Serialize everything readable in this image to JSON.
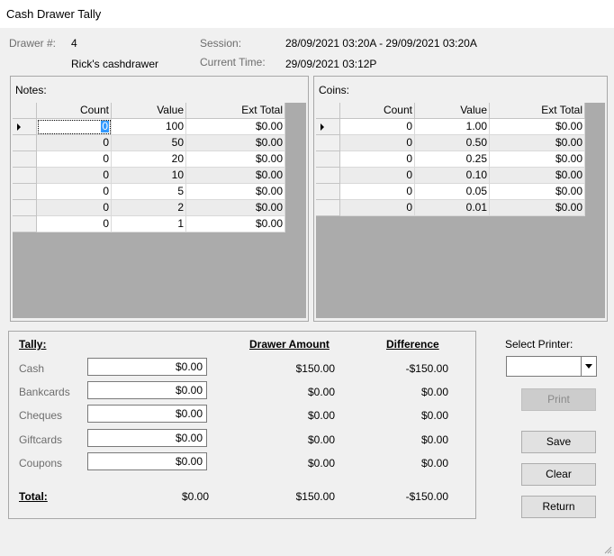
{
  "window": {
    "title": "Cash Drawer Tally"
  },
  "header": {
    "drawer_label": "Drawer #:",
    "drawer_number": "4",
    "drawer_name": "Rick's cashdrawer",
    "session_label": "Session:",
    "session_value": "28/09/2021 03:20A - 29/09/2021 03:20A",
    "current_time_label": "Current Time:",
    "current_time_value": "29/09/2021 03:12P"
  },
  "notes": {
    "title": "Notes:",
    "columns": [
      "Count",
      "Value",
      "Ext Total"
    ],
    "rows": [
      [
        "0",
        "100",
        "$0.00"
      ],
      [
        "0",
        "50",
        "$0.00"
      ],
      [
        "0",
        "20",
        "$0.00"
      ],
      [
        "0",
        "10",
        "$0.00"
      ],
      [
        "0",
        "5",
        "$0.00"
      ],
      [
        "0",
        "2",
        "$0.00"
      ],
      [
        "0",
        "1",
        "$0.00"
      ]
    ]
  },
  "coins": {
    "title": "Coins:",
    "columns": [
      "Count",
      "Value",
      "Ext Total"
    ],
    "rows": [
      [
        "0",
        "1.00",
        "$0.00"
      ],
      [
        "0",
        "0.50",
        "$0.00"
      ],
      [
        "0",
        "0.25",
        "$0.00"
      ],
      [
        "0",
        "0.10",
        "$0.00"
      ],
      [
        "0",
        "0.05",
        "$0.00"
      ],
      [
        "0",
        "0.01",
        "$0.00"
      ]
    ]
  },
  "tally": {
    "heading": "Tally:",
    "drawer_amount_heading": "Drawer Amount",
    "difference_heading": "Difference",
    "rows": [
      {
        "label": "Cash",
        "tally": "$0.00",
        "drawer": "$150.00",
        "difference": "-$150.00"
      },
      {
        "label": "Bankcards",
        "tally": "$0.00",
        "drawer": "$0.00",
        "difference": "$0.00"
      },
      {
        "label": "Cheques",
        "tally": "$0.00",
        "drawer": "$0.00",
        "difference": "$0.00"
      },
      {
        "label": "Giftcards",
        "tally": "$0.00",
        "drawer": "$0.00",
        "difference": "$0.00"
      },
      {
        "label": "Coupons",
        "tally": "$0.00",
        "drawer": "$0.00",
        "difference": "$0.00"
      }
    ],
    "total": {
      "label": "Total:",
      "tally": "$0.00",
      "drawer": "$150.00",
      "difference": "-$150.00"
    }
  },
  "printer": {
    "label": "Select Printer:",
    "selected": ""
  },
  "buttons": {
    "print": "Print",
    "save": "Save",
    "clear": "Clear",
    "return": "Return"
  }
}
